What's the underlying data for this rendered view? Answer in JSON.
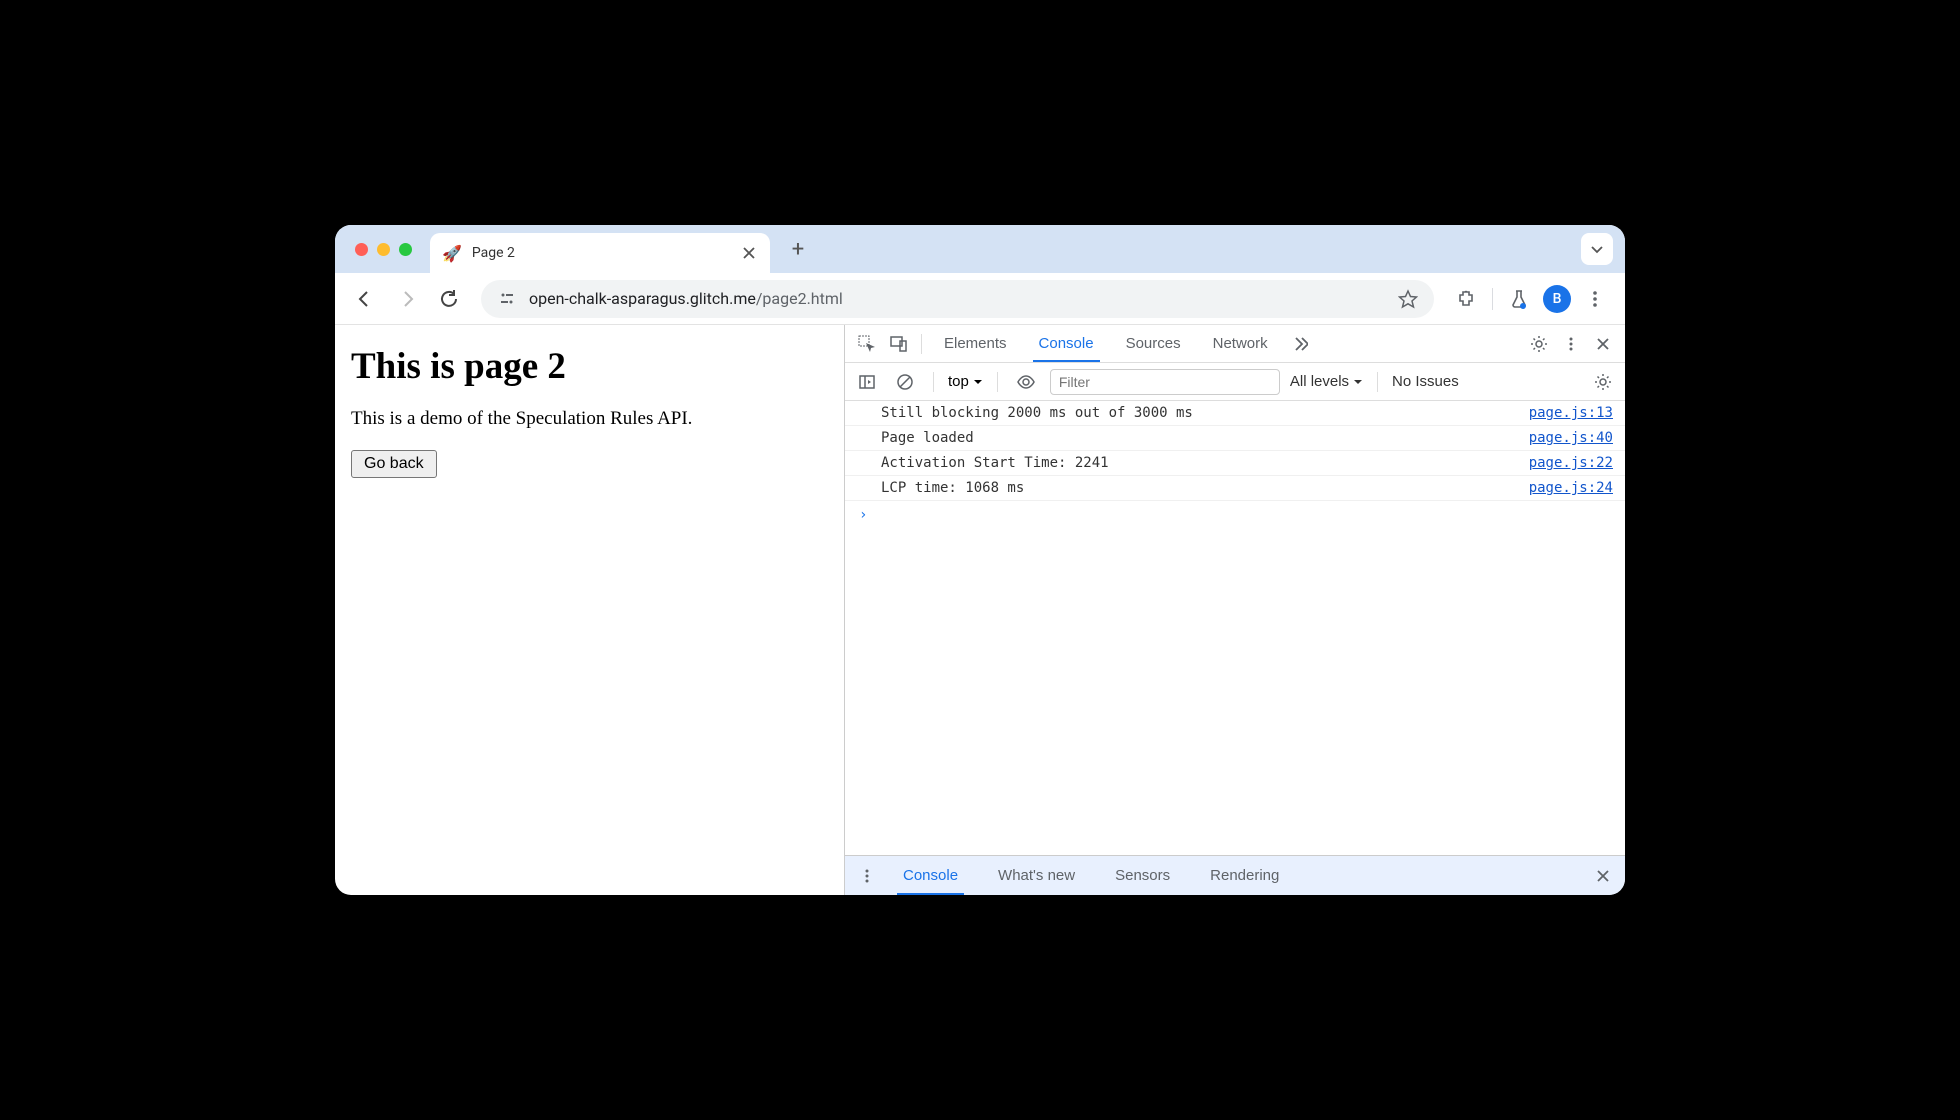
{
  "tab": {
    "favicon": "🚀",
    "title": "Page 2"
  },
  "address": {
    "host": "open-chalk-asparagus.glitch.me",
    "path": "/page2.html"
  },
  "avatar_initial": "B",
  "page": {
    "heading": "This is page 2",
    "paragraph": "This is a demo of the Speculation Rules API.",
    "button": "Go back"
  },
  "devtools": {
    "tabs": [
      "Elements",
      "Console",
      "Sources",
      "Network"
    ],
    "active_tab": "Console",
    "console_toolbar": {
      "context": "top",
      "filter_placeholder": "Filter",
      "levels": "All levels",
      "issues": "No Issues"
    },
    "logs": [
      {
        "message": "Still blocking 2000 ms out of 3000 ms",
        "source": "page.js:13"
      },
      {
        "message": "Page loaded",
        "source": "page.js:40"
      },
      {
        "message": "Activation Start Time: 2241",
        "source": "page.js:22"
      },
      {
        "message": "LCP time: 1068 ms",
        "source": "page.js:24"
      }
    ],
    "drawer_tabs": [
      "Console",
      "What's new",
      "Sensors",
      "Rendering"
    ],
    "drawer_active": "Console"
  }
}
